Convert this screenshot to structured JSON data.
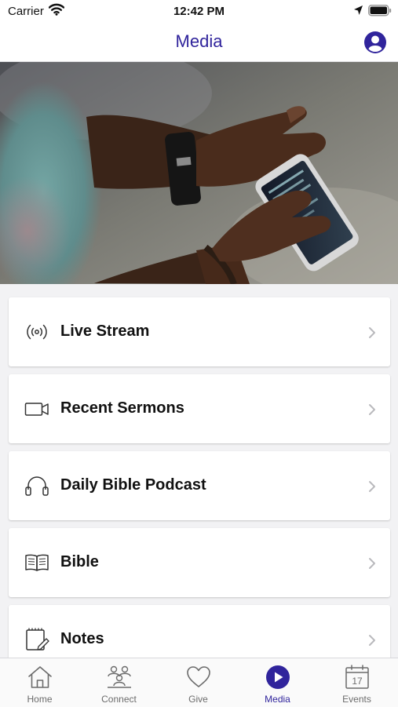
{
  "status_bar": {
    "carrier": "Carrier",
    "time": "12:42 PM"
  },
  "header": {
    "title": "Media",
    "profile_icon": "person-circle-icon"
  },
  "colors": {
    "accent": "#30249c",
    "inactive_tab": "#6b6b6b",
    "background": "#f2f2f4"
  },
  "menu": {
    "items": [
      {
        "label": "Live Stream",
        "icon": "broadcast-icon"
      },
      {
        "label": "Recent Sermons",
        "icon": "video-camera-icon"
      },
      {
        "label": "Daily Bible Podcast",
        "icon": "headphones-icon"
      },
      {
        "label": "Bible",
        "icon": "open-book-icon"
      },
      {
        "label": "Notes",
        "icon": "notepad-icon"
      }
    ]
  },
  "tabs": [
    {
      "label": "Home",
      "icon": "house-icon",
      "active": false
    },
    {
      "label": "Connect",
      "icon": "people-group-icon",
      "active": false
    },
    {
      "label": "Give",
      "icon": "heart-icon",
      "active": false
    },
    {
      "label": "Media",
      "icon": "play-circle-icon",
      "active": true
    },
    {
      "label": "Events",
      "icon": "calendar-icon",
      "active": false,
      "calendar_day": "17"
    }
  ]
}
